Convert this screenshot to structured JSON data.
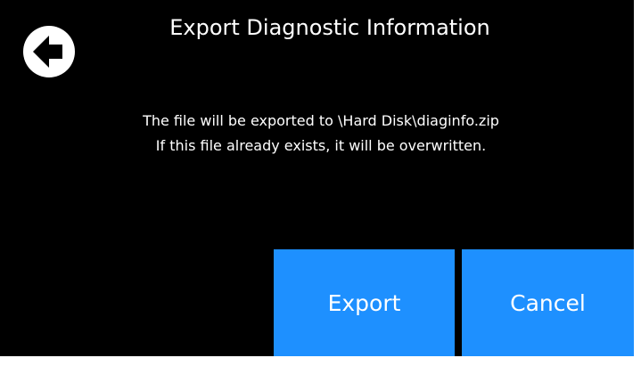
{
  "dialog": {
    "title": "Export Diagnostic Information",
    "message_line1": "The file will be exported to \\Hard Disk\\diaginfo.zip",
    "message_line2": "If this file already exists, it will be overwritten."
  },
  "buttons": {
    "back_icon": "back-arrow-icon",
    "export_label": "Export",
    "cancel_label": "Cancel"
  },
  "colors": {
    "background": "#000000",
    "button": "#1e90ff",
    "text": "#ffffff",
    "frame": "#ffffff"
  }
}
